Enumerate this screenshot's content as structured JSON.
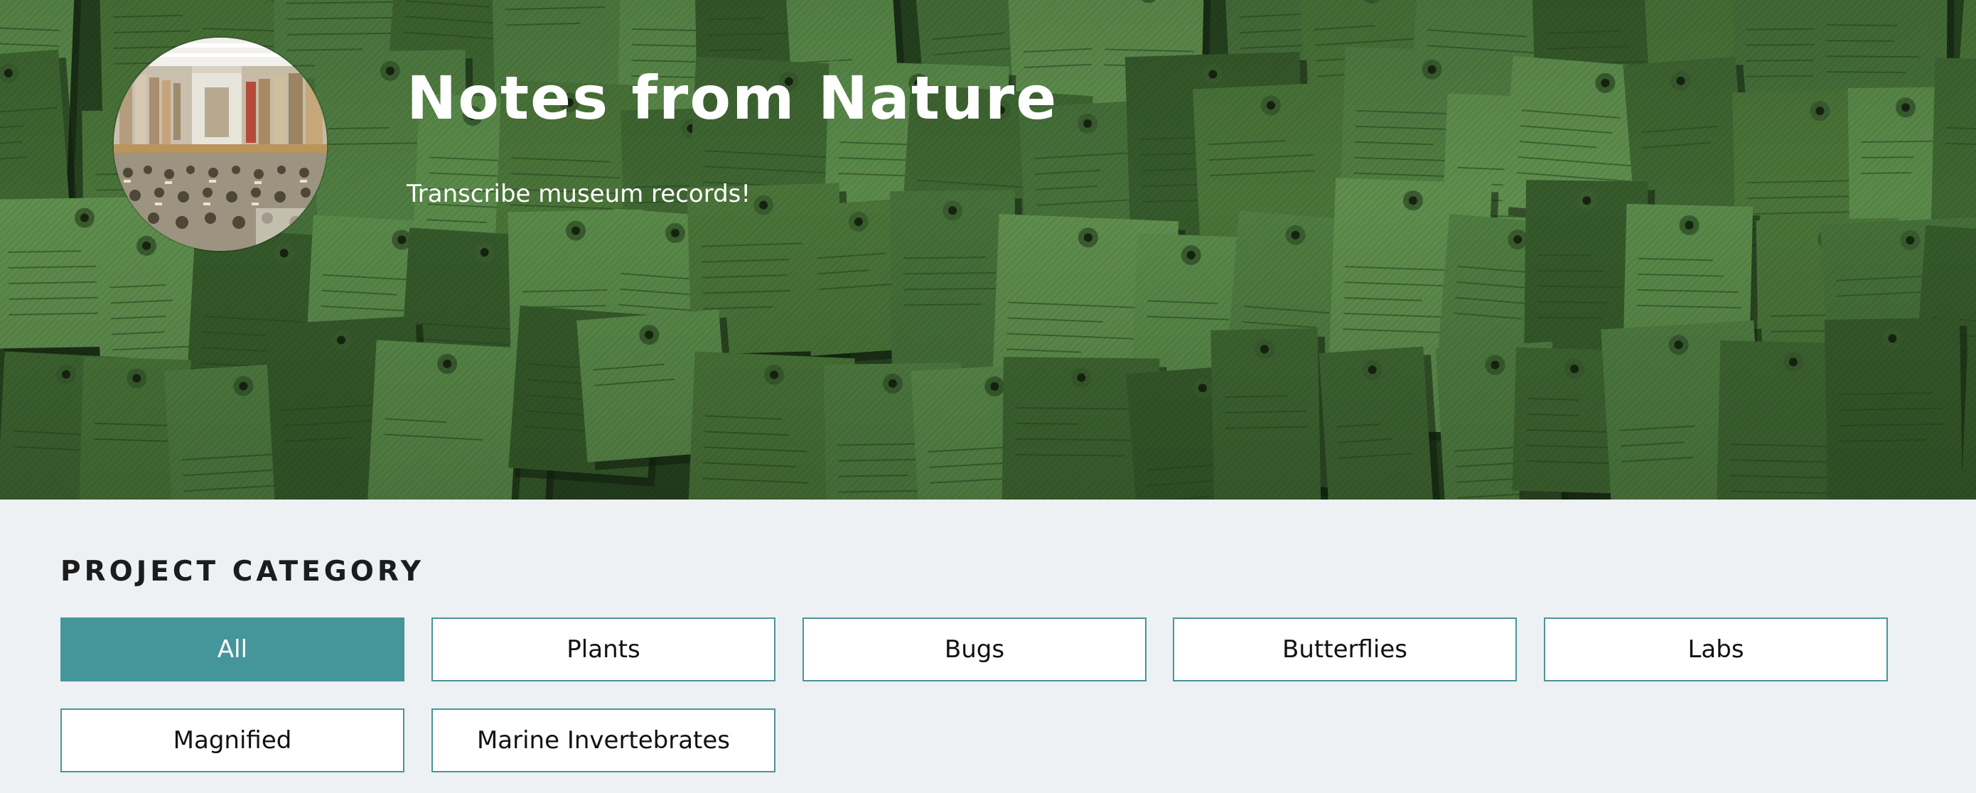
{
  "hero": {
    "title": "Notes from Nature",
    "tagline": "Transcribe museum records!"
  },
  "category": {
    "heading": "PROJECT CATEGORY",
    "active_index": 0,
    "buttons": [
      {
        "label": "All"
      },
      {
        "label": "Plants"
      },
      {
        "label": "Bugs"
      },
      {
        "label": "Butterflies"
      },
      {
        "label": "Labs"
      },
      {
        "label": "Magnified"
      },
      {
        "label": "Marine Invertebrates"
      }
    ]
  },
  "colors": {
    "accent": "#44969b",
    "page_background": "#edf1f4",
    "hero_tint": "#4e7a3f"
  }
}
